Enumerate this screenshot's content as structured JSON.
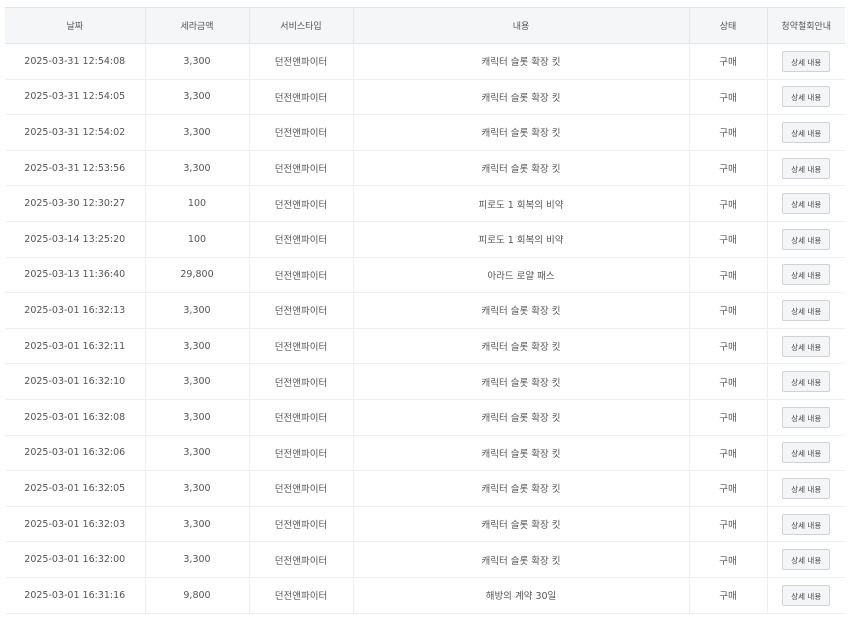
{
  "headers": {
    "date": "날짜",
    "amount": "세라금액",
    "service": "서비스타입",
    "content": "내용",
    "status": "상태",
    "withdrawal": "청약철회안내"
  },
  "detail_label": "상세 내용",
  "rows": [
    {
      "date": "2025-03-31 12:54:08",
      "amount": "3,300",
      "service": "던전앤파이터",
      "content": "캐릭터 슬롯 확장 킷",
      "status": "구매"
    },
    {
      "date": "2025-03-31 12:54:05",
      "amount": "3,300",
      "service": "던전앤파이터",
      "content": "캐릭터 슬롯 확장 킷",
      "status": "구매"
    },
    {
      "date": "2025-03-31 12:54:02",
      "amount": "3,300",
      "service": "던전앤파이터",
      "content": "캐릭터 슬롯 확장 킷",
      "status": "구매"
    },
    {
      "date": "2025-03-31 12:53:56",
      "amount": "3,300",
      "service": "던전앤파이터",
      "content": "캐릭터 슬롯 확장 킷",
      "status": "구매"
    },
    {
      "date": "2025-03-30 12:30:27",
      "amount": "100",
      "service": "던전앤파이터",
      "content": "피로도 1 회복의 비약",
      "status": "구매"
    },
    {
      "date": "2025-03-14 13:25:20",
      "amount": "100",
      "service": "던전앤파이터",
      "content": "피로도 1 회복의 비약",
      "status": "구매"
    },
    {
      "date": "2025-03-13 11:36:40",
      "amount": "29,800",
      "service": "던전앤파이터",
      "content": "아라드 로얄 패스",
      "status": "구매"
    },
    {
      "date": "2025-03-01 16:32:13",
      "amount": "3,300",
      "service": "던전앤파이터",
      "content": "캐릭터 슬롯 확장 킷",
      "status": "구매"
    },
    {
      "date": "2025-03-01 16:32:11",
      "amount": "3,300",
      "service": "던전앤파이터",
      "content": "캐릭터 슬롯 확장 킷",
      "status": "구매"
    },
    {
      "date": "2025-03-01 16:32:10",
      "amount": "3,300",
      "service": "던전앤파이터",
      "content": "캐릭터 슬롯 확장 킷",
      "status": "구매"
    },
    {
      "date": "2025-03-01 16:32:08",
      "amount": "3,300",
      "service": "던전앤파이터",
      "content": "캐릭터 슬롯 확장 킷",
      "status": "구매"
    },
    {
      "date": "2025-03-01 16:32:06",
      "amount": "3,300",
      "service": "던전앤파이터",
      "content": "캐릭터 슬롯 확장 킷",
      "status": "구매"
    },
    {
      "date": "2025-03-01 16:32:05",
      "amount": "3,300",
      "service": "던전앤파이터",
      "content": "캐릭터 슬롯 확장 킷",
      "status": "구매"
    },
    {
      "date": "2025-03-01 16:32:03",
      "amount": "3,300",
      "service": "던전앤파이터",
      "content": "캐릭터 슬롯 확장 킷",
      "status": "구매"
    },
    {
      "date": "2025-03-01 16:32:00",
      "amount": "3,300",
      "service": "던전앤파이터",
      "content": "캐릭터 슬롯 확장 킷",
      "status": "구매"
    },
    {
      "date": "2025-03-01 16:31:16",
      "amount": "9,800",
      "service": "던전앤파이터",
      "content": "해방의 계약 30일",
      "status": "구매"
    }
  ]
}
